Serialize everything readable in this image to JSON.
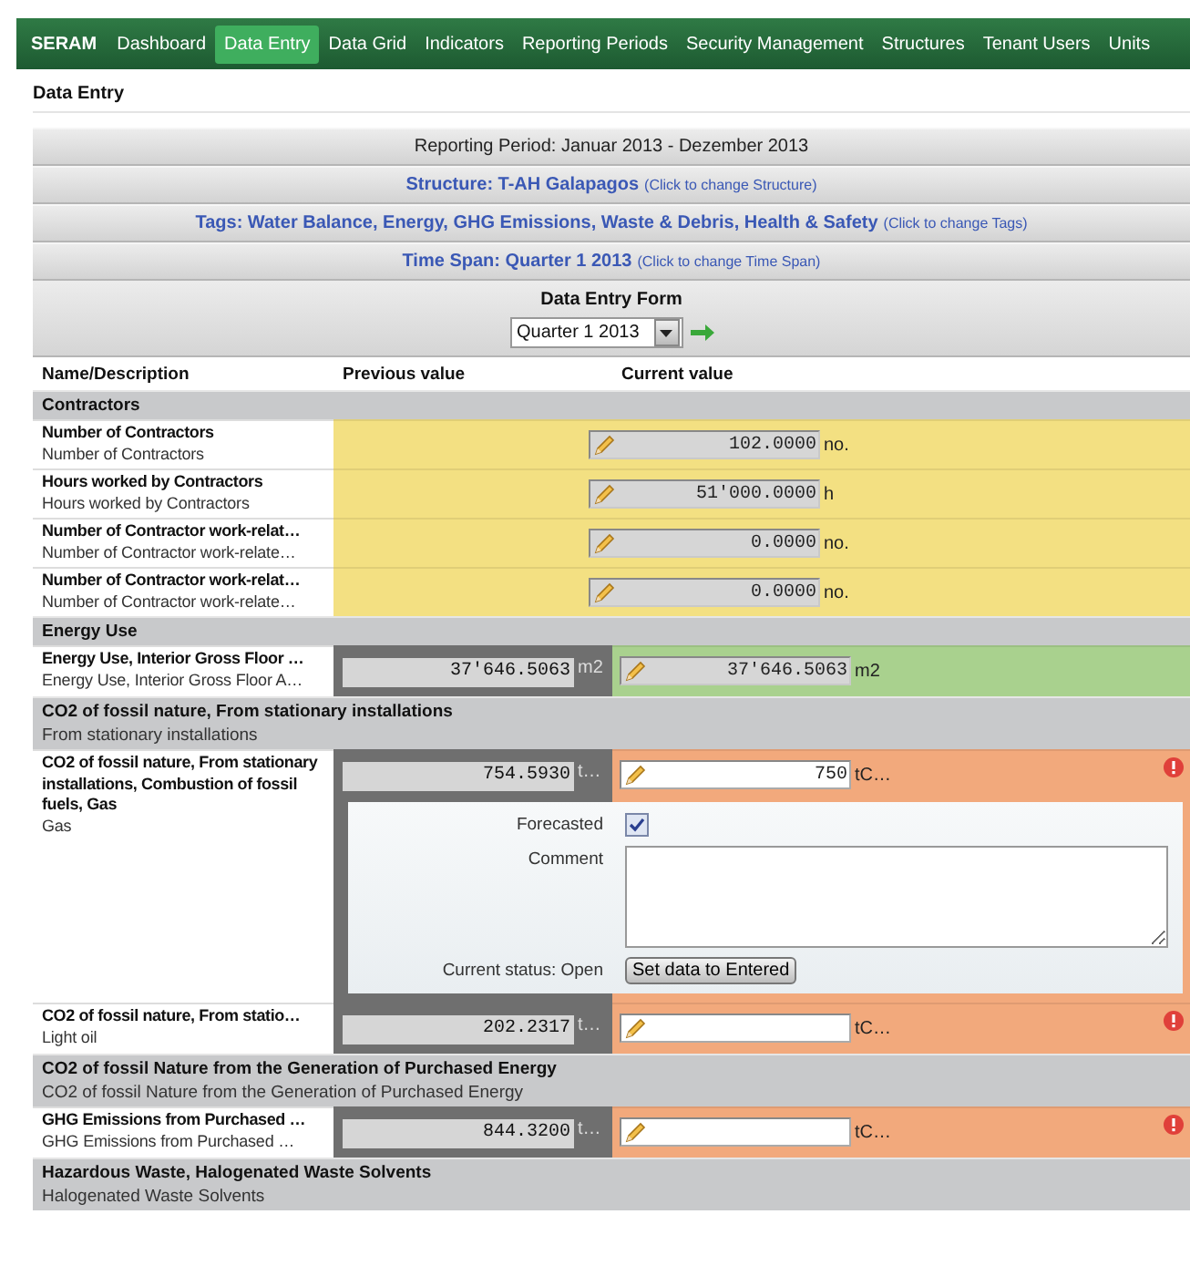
{
  "nav": {
    "brand": "SERAM",
    "items": [
      {
        "label": "Dashboard",
        "selected": false
      },
      {
        "label": "Data Entry",
        "selected": true
      },
      {
        "label": "Data Grid",
        "selected": false
      },
      {
        "label": "Indicators",
        "selected": false
      },
      {
        "label": "Reporting Periods",
        "selected": false
      },
      {
        "label": "Security Management",
        "selected": false
      },
      {
        "label": "Structures",
        "selected": false
      },
      {
        "label": "Tenant Users",
        "selected": false
      },
      {
        "label": "Units",
        "selected": false
      }
    ]
  },
  "page_title": "Data Entry",
  "reporting_period": "Reporting Period: Januar 2013 - Dezember 2013",
  "selectors": [
    {
      "label": "Structure: T-AH Galapagos",
      "hint": "(Click to change Structure)"
    },
    {
      "label": "Tags: Water Balance, Energy, GHG Emissions, Waste & Debris, Health & Safety",
      "hint": "(Click to change Tags)"
    },
    {
      "label": "Time Span: Quarter 1 2013",
      "hint": "(Click to change Time Span)"
    }
  ],
  "form": {
    "title": "Data Entry Form",
    "period": "Quarter 1 2013"
  },
  "columns": [
    "Name/Description",
    "Previous value",
    "Current value"
  ],
  "sections": [
    {
      "title": "Contractors",
      "rows": [
        {
          "kind": "pending",
          "name": "Number of Contractors",
          "description": "Number of Contractors",
          "current": "102.0000",
          "unit": "no."
        },
        {
          "kind": "pending",
          "name": "Hours worked by Contractors",
          "description": "Hours worked by Contractors",
          "current": "51'000.0000",
          "unit": "h"
        },
        {
          "kind": "pending",
          "name": "Number of Contractor work-relat…",
          "description": "Number of Contractor work-relate…",
          "current": "0.0000",
          "unit": "no."
        },
        {
          "kind": "pending",
          "name": "Number of Contractor work-relat…",
          "description": "Number of Contractor work-relate…",
          "current": "0.0000",
          "unit": "no."
        }
      ]
    },
    {
      "title": "Energy Use",
      "rows": [
        {
          "kind": "ok",
          "name": "Energy Use, Interior Gross Floor …",
          "description": "Energy Use, Interior Gross Floor A…",
          "previous": "37'646.5063",
          "previous_unit": "m2",
          "current": "37'646.5063",
          "unit": "m2"
        }
      ]
    },
    {
      "title": "CO2 of fossil nature, From stationary installations",
      "description": "From stationary installations",
      "rows": [
        {
          "kind": "error",
          "name": "CO2 of fossil nature, From stationary installations, Combustion of fossil fuels, Gas",
          "description": "Gas",
          "previous": "754.5930",
          "previous_unit": "t…",
          "current": "750",
          "unit": "tC…",
          "detail": {
            "forecasted_label": "Forecasted",
            "forecasted": true,
            "comment_label": "Comment",
            "status": "Current status: Open",
            "button": "Set data to Entered"
          }
        },
        {
          "kind": "error",
          "name": "CO2 of fossil nature, From statio…",
          "description": "Light oil",
          "previous": "202.2317",
          "previous_unit": "t…",
          "unit": "tC…"
        }
      ]
    },
    {
      "title": "CO2 of fossil Nature from the Generation of Purchased Energy",
      "description": "CO2 of fossil Nature from the Generation of Purchased Energy",
      "rows": [
        {
          "kind": "error",
          "name": "GHG Emissions from Purchased …",
          "description": "GHG Emissions from Purchased …",
          "previous": "844.3200",
          "previous_unit": "t…",
          "unit": "tC…"
        }
      ]
    },
    {
      "title": "Hazardous Waste, Halogenated Waste Solvents",
      "description": "Halogenated Waste Solvents"
    }
  ]
}
